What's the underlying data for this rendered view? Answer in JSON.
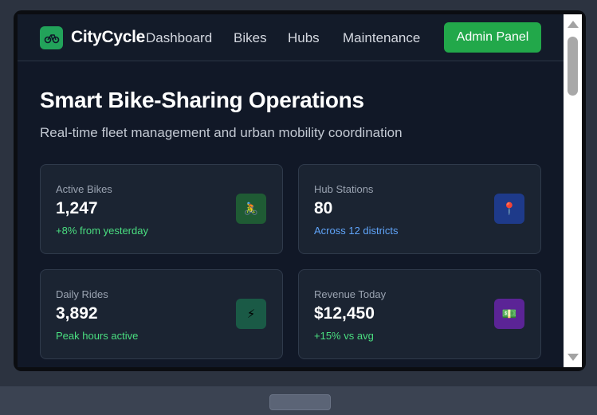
{
  "nav": {
    "brand": "CityCycle",
    "logo_icon": "bike-icon",
    "links": [
      "Dashboard",
      "Bikes",
      "Hubs",
      "Maintenance"
    ],
    "admin_button": "Admin Panel"
  },
  "hero": {
    "title": "Smart Bike-Sharing Operations",
    "subtitle": "Real-time fleet management and urban mobility coordination"
  },
  "stats": [
    {
      "label": "Active Bikes",
      "value": "1,247",
      "note": "+8% from yesterday",
      "note_color": "#4ade80",
      "icon": "cyclist-icon",
      "glyph": "🚴",
      "icon_bg": "#1f5b34"
    },
    {
      "label": "Hub Stations",
      "value": "80",
      "note": "Across 12 districts",
      "note_color": "#60a5fa",
      "icon": "pin-icon",
      "glyph": "📍",
      "icon_bg": "#1e3a8a"
    },
    {
      "label": "Daily Rides",
      "value": "3,892",
      "note": "Peak hours active",
      "note_color": "#4ade80",
      "icon": "lightning-icon",
      "glyph": "⚡",
      "icon_bg": "#1a5a46"
    },
    {
      "label": "Revenue Today",
      "value": "$12,450",
      "note": "+15% vs avg",
      "note_color": "#4ade80",
      "icon": "money-icon",
      "glyph": "💵",
      "icon_bg": "#5b2496"
    }
  ],
  "colors": {
    "accent": "#22a84a",
    "background": "#111827",
    "card": "#1b2432"
  }
}
